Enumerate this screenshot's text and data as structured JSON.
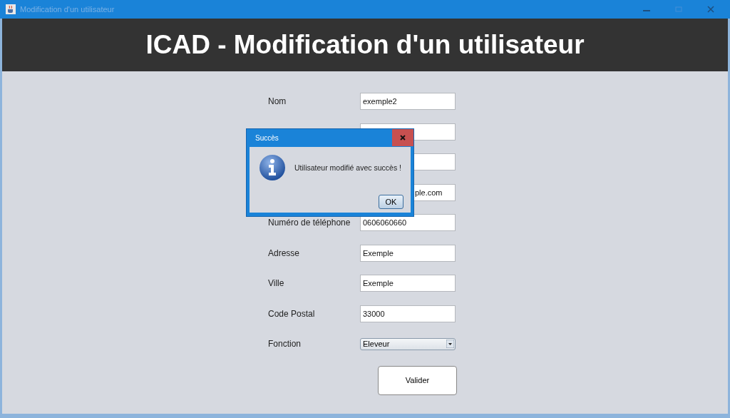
{
  "window": {
    "title": "Modification d'un utilisateur"
  },
  "header": {
    "title": "ICAD - Modification d'un utilisateur"
  },
  "fields": [
    {
      "label": "Nom",
      "value": "exemple2",
      "kind": "text"
    },
    {
      "kind": "text"
    },
    {
      "kind": "text"
    },
    {
      "value": "ple.com",
      "kind": "partial"
    },
    {
      "label": "Numéro de téléphone",
      "value": "0606060660",
      "kind": "text"
    },
    {
      "label": "Adresse",
      "value": "Exemple",
      "kind": "text"
    },
    {
      "label": "Ville",
      "value": "Exemple",
      "kind": "text"
    },
    {
      "label": "Code Postal",
      "value": "33000",
      "kind": "text"
    },
    {
      "label": "Fonction",
      "value": "Eleveur",
      "kind": "select"
    }
  ],
  "submit_button": "Valider",
  "dialog": {
    "title": "Succès",
    "message": "Utilisateur modifié avec succès !",
    "button": "OK"
  }
}
